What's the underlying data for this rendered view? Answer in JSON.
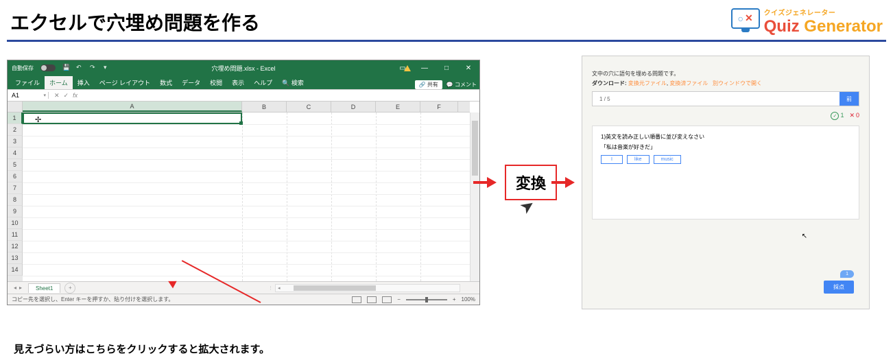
{
  "title": "エクセルで穴埋め問題を作る",
  "logo": {
    "jp": "クイズジェネレーター",
    "quiz": "Quiz ",
    "gen": "Generator"
  },
  "excel": {
    "autosave": "自動保存",
    "filename": "穴埋め問題.xlsx - Excel",
    "tabs": [
      "ファイル",
      "ホーム",
      "挿入",
      "ページ レイアウト",
      "数式",
      "データ",
      "校閲",
      "表示",
      "ヘルプ"
    ],
    "search_hint": "検索",
    "share": "共有",
    "comments": "コメント",
    "name_box": "A1",
    "columns": [
      "A",
      "B",
      "C",
      "D",
      "E",
      "F"
    ],
    "rows": [
      "1",
      "2",
      "3",
      "4",
      "5",
      "6",
      "7",
      "8",
      "9",
      "10",
      "11",
      "12",
      "13",
      "14"
    ],
    "sheet_tab": "Sheet1",
    "status": "コピー先を選択し、Enter キーを押すか、貼り付けを選択します。",
    "zoom": "100%"
  },
  "transform": "変換",
  "quiz": {
    "desc": "文中の穴に語句を埋める問題です。",
    "dl_label": "ダウンロード: ",
    "dl_link1": "変換元ファイル",
    "dl_link2": "変換済ファイル",
    "dl_link3": "別ウィンドウで開く",
    "progress": "1 / 5",
    "prog_btn": "前",
    "score_ok": "1",
    "score_ng": "0",
    "q_text": "1)英文を読み正しい順番に並び変えなさい",
    "q_sentence": "「私は音楽が好きだ」",
    "tokens": [
      "I",
      "like",
      "music"
    ],
    "bubble": "1",
    "submit": "採点"
  },
  "bottom_text": "見えづらい方はこちらをクリックすると拡大されます。"
}
